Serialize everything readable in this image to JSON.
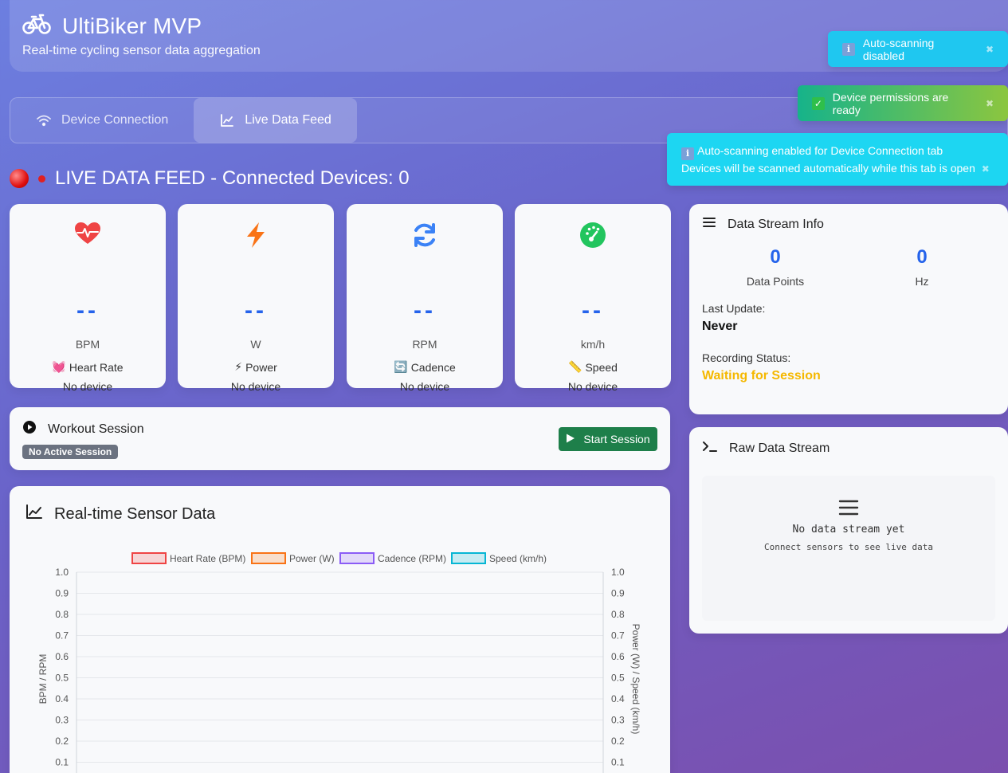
{
  "header": {
    "title": "UltiBiker MVP",
    "subtitle": "Real-time cycling sensor data aggregation",
    "icon": "bicycle-icon"
  },
  "tabs": [
    {
      "label": "Device Connection",
      "icon": "wifi-icon",
      "active": false
    },
    {
      "label": "Live Data Feed",
      "icon": "chart-line-icon",
      "active": true
    }
  ],
  "live": {
    "heading": "LIVE DATA FEED - Connected Devices: 0"
  },
  "metrics": [
    {
      "icon": "heart-pulse-icon",
      "value": "--",
      "unit": "BPM",
      "emoji": "💓",
      "label": "Heart Rate",
      "status": "No device",
      "color": "#ef4444"
    },
    {
      "icon": "lightning-icon",
      "value": "--",
      "unit": "W",
      "emoji": "⚡",
      "label": "Power",
      "status": "No device",
      "color": "#f97316"
    },
    {
      "icon": "refresh-icon",
      "value": "--",
      "unit": "RPM",
      "emoji": "🔄",
      "label": "Cadence",
      "status": "No device",
      "color": "#3b82f6"
    },
    {
      "icon": "speedometer-icon",
      "value": "--",
      "unit": "km/h",
      "emoji": "📏",
      "label": "Speed",
      "status": "No device",
      "color": "#22c55e"
    }
  ],
  "session": {
    "title": "Workout Session",
    "badge": "No Active Session",
    "start_label": "Start Session"
  },
  "chart_card": {
    "title": "Real-time Sensor Data"
  },
  "chart_data": {
    "type": "line",
    "title": "",
    "series": [
      {
        "name": "Heart Rate (BPM)",
        "color": "#ef4444",
        "values": []
      },
      {
        "name": "Power (W)",
        "color": "#f97316",
        "values": []
      },
      {
        "name": "Cadence (RPM)",
        "color": "#8b5cf6",
        "values": []
      },
      {
        "name": "Speed (km/h)",
        "color": "#06b6d4",
        "values": []
      }
    ],
    "ylabel_left": "BPM / RPM",
    "ylabel_right": "Power (W) / Speed (km/h)",
    "y_ticks": [
      "1.0",
      "0.9",
      "0.8",
      "0.7",
      "0.6",
      "0.5",
      "0.4",
      "0.3",
      "0.2",
      "0.1"
    ],
    "ylim": [
      0,
      1
    ],
    "grid": true,
    "legend": "top"
  },
  "info": {
    "title": "Data Stream Info",
    "data_points": "0",
    "data_points_label": "Data Points",
    "hz": "0",
    "hz_label": "Hz",
    "last_update_label": "Last Update:",
    "last_update": "Never",
    "recording_label": "Recording Status:",
    "recording": "Waiting for Session"
  },
  "raw": {
    "title": "Raw Data Stream",
    "empty_title": "No data stream yet",
    "empty_sub": "Connect sensors to see live data"
  },
  "toasts": [
    {
      "text": "Auto-scanning disabled",
      "close": "✖"
    },
    {
      "text": "Device permissions are ready",
      "close": "✖"
    },
    {
      "line1": "Auto-scanning enabled for Device Connection tab",
      "line2": "Devices will be scanned automatically while this tab is open",
      "close": "✖"
    }
  ]
}
